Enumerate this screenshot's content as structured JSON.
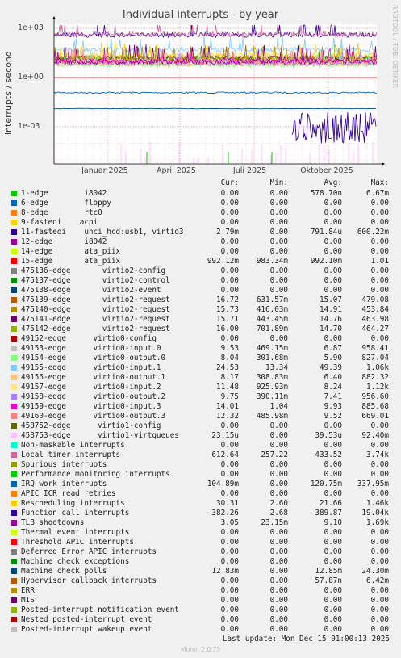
{
  "chart_data": {
    "type": "line",
    "title": "Individual interrupts - by year",
    "ylabel": "interrupts / second",
    "y_scale": "log",
    "y_ticks": [
      "1e+03",
      "1e+00",
      "1e-03"
    ],
    "x_ticks": [
      "Januar 2025",
      "April 2025",
      "Juli 2025",
      "Oktober 2025"
    ],
    "grid": true,
    "watermark": "RRDTOOL / TOBI OETIKER",
    "columns": [
      "Cur:",
      "Min:",
      "Avg:",
      "Max:"
    ],
    "series": [
      {
        "name": "1-edge        i8042",
        "color": "#00cc00",
        "cur": "0.00",
        "min": "0.00",
        "avg": "578.70n",
        "max": "6.67m"
      },
      {
        "name": "6-edge        floppy",
        "color": "#0066b3",
        "cur": "0.00",
        "min": "0.00",
        "avg": "0.00",
        "max": "0.00"
      },
      {
        "name": "8-edge        rtc0",
        "color": "#ff8000",
        "cur": "0.00",
        "min": "0.00",
        "avg": "0.00",
        "max": "0.00"
      },
      {
        "name": "9-fasteoi    acpi",
        "color": "#ffcc00",
        "cur": "0.00",
        "min": "0.00",
        "avg": "0.00",
        "max": "0.00"
      },
      {
        "name": "11-fasteoi    uhci_hcd:usb1, virtio3",
        "color": "#330099",
        "cur": "2.79m",
        "min": "0.00",
        "avg": "791.84u",
        "max": "600.22m"
      },
      {
        "name": "12-edge       i8042",
        "color": "#990099",
        "cur": "0.00",
        "min": "0.00",
        "avg": "0.00",
        "max": "0.00"
      },
      {
        "name": "14-edge       ata_piix",
        "color": "#ccff00",
        "cur": "0.00",
        "min": "0.00",
        "avg": "0.00",
        "max": "0.00"
      },
      {
        "name": "15-edge       ata_piix",
        "color": "#ff0000",
        "cur": "992.12m",
        "min": "983.34m",
        "avg": "992.10m",
        "max": "1.01"
      },
      {
        "name": "475136-edge       virtio2-config",
        "color": "#808080",
        "cur": "0.00",
        "min": "0.00",
        "avg": "0.00",
        "max": "0.00"
      },
      {
        "name": "475137-edge       virtio2-control",
        "color": "#008f00",
        "cur": "0.00",
        "min": "0.00",
        "avg": "0.00",
        "max": "0.00"
      },
      {
        "name": "475138-edge       virtio2-event",
        "color": "#00487d",
        "cur": "0.00",
        "min": "0.00",
        "avg": "0.00",
        "max": "0.00"
      },
      {
        "name": "475139-edge       virtio2-request",
        "color": "#b35a00",
        "cur": "16.72",
        "min": "631.57m",
        "avg": "15.07",
        "max": "479.08"
      },
      {
        "name": "475140-edge       virtio2-request",
        "color": "#b38f00",
        "cur": "15.73",
        "min": "416.03m",
        "avg": "14.91",
        "max": "453.84"
      },
      {
        "name": "475141-edge       virtio2-request",
        "color": "#6b006b",
        "cur": "15.71",
        "min": "443.45m",
        "avg": "14.76",
        "max": "463.98"
      },
      {
        "name": "475142-edge       virtio2-request",
        "color": "#8fb300",
        "cur": "16.00",
        "min": "701.89m",
        "avg": "14.70",
        "max": "464.27"
      },
      {
        "name": "49152-edge      virtio0-config",
        "color": "#b30000",
        "cur": "0.00",
        "min": "0.00",
        "avg": "0.00",
        "max": "0.00"
      },
      {
        "name": "49153-edge      virtio0-input.0",
        "color": "#bebebe",
        "cur": "9.53",
        "min": "469.15m",
        "avg": "6.87",
        "max": "958.41"
      },
      {
        "name": "49154-edge      virtio0-output.0",
        "color": "#80ff80",
        "cur": "8.04",
        "min": "301.68m",
        "avg": "5.90",
        "max": "827.04"
      },
      {
        "name": "49155-edge      virtio0-input.1",
        "color": "#80c9ff",
        "cur": "24.53",
        "min": "13.34",
        "avg": "49.39",
        "max": "1.06k"
      },
      {
        "name": "49156-edge      virtio0-output.1",
        "color": "#ffc080",
        "cur": "8.17",
        "min": "308.83m",
        "avg": "6.40",
        "max": "882.32"
      },
      {
        "name": "49157-edge      virtio0-input.2",
        "color": "#ffe680",
        "cur": "11.48",
        "min": "925.93m",
        "avg": "8.24",
        "max": "1.12k"
      },
      {
        "name": "49158-edge      virtio0-output.2",
        "color": "#aa80ff",
        "cur": "9.75",
        "min": "390.11m",
        "avg": "7.41",
        "max": "956.60"
      },
      {
        "name": "49159-edge      virtio0-input.3",
        "color": "#ee00cc",
        "cur": "14.01",
        "min": "1.04",
        "avg": "9.93",
        "max": "885.68"
      },
      {
        "name": "49160-edge      virtio0-output.3",
        "color": "#ff8080",
        "cur": "12.32",
        "min": "485.98m",
        "avg": "9.52",
        "max": "669.01"
      },
      {
        "name": "458752-edge      virtio1-config",
        "color": "#666600",
        "cur": "0.00",
        "min": "0.00",
        "avg": "0.00",
        "max": "0.00"
      },
      {
        "name": "458753-edge      virtio1-virtqueues",
        "color": "#ffbfff",
        "cur": "23.15u",
        "min": "0.00",
        "avg": "39.53u",
        "max": "92.40m"
      },
      {
        "name": "Non-maskable interrupts",
        "color": "#00ffcc",
        "cur": "0.00",
        "min": "0.00",
        "avg": "0.00",
        "max": "0.00"
      },
      {
        "name": "Local timer interrupts",
        "color": "#cc6699",
        "cur": "612.64",
        "min": "257.22",
        "avg": "433.52",
        "max": "3.74k"
      },
      {
        "name": "Spurious interrupts",
        "color": "#999900",
        "cur": "0.00",
        "min": "0.00",
        "avg": "0.00",
        "max": "0.00"
      },
      {
        "name": "Performance monitoring interrupts",
        "color": "#00cc00",
        "cur": "0.00",
        "min": "0.00",
        "avg": "0.00",
        "max": "0.00"
      },
      {
        "name": "IRQ work interrupts",
        "color": "#0066b3",
        "cur": "104.89m",
        "min": "0.00",
        "avg": "120.75m",
        "max": "337.95m"
      },
      {
        "name": "APIC ICR read retries",
        "color": "#ff8000",
        "cur": "0.00",
        "min": "0.00",
        "avg": "0.00",
        "max": "0.00"
      },
      {
        "name": "Rescheduling interrupts",
        "color": "#ffcc00",
        "cur": "30.31",
        "min": "2.60",
        "avg": "21.66",
        "max": "1.46k"
      },
      {
        "name": "Function call interrupts",
        "color": "#330099",
        "cur": "382.26",
        "min": "2.68",
        "avg": "389.87",
        "max": "19.04k"
      },
      {
        "name": "TLB shootdowns",
        "color": "#990099",
        "cur": "3.05",
        "min": "23.15m",
        "avg": "9.10",
        "max": "1.69k"
      },
      {
        "name": "Thermal event interrupts",
        "color": "#ccff00",
        "cur": "0.00",
        "min": "0.00",
        "avg": "0.00",
        "max": "0.00"
      },
      {
        "name": "Threshold APIC interrupts",
        "color": "#ff0000",
        "cur": "0.00",
        "min": "0.00",
        "avg": "0.00",
        "max": "0.00"
      },
      {
        "name": "Deferred Error APIC interrupts",
        "color": "#808080",
        "cur": "0.00",
        "min": "0.00",
        "avg": "0.00",
        "max": "0.00"
      },
      {
        "name": "Machine check exceptions",
        "color": "#008f00",
        "cur": "0.00",
        "min": "0.00",
        "avg": "0.00",
        "max": "0.00"
      },
      {
        "name": "Machine check polls",
        "color": "#00487d",
        "cur": "12.83m",
        "min": "0.00",
        "avg": "12.85m",
        "max": "24.30m"
      },
      {
        "name": "Hypervisor callback interrupts",
        "color": "#b35a00",
        "cur": "0.00",
        "min": "0.00",
        "avg": "57.87n",
        "max": "6.42m"
      },
      {
        "name": "ERR",
        "color": "#b38f00",
        "cur": "0.00",
        "min": "0.00",
        "avg": "0.00",
        "max": "0.00"
      },
      {
        "name": "MIS",
        "color": "#6b006b",
        "cur": "0.00",
        "min": "0.00",
        "avg": "0.00",
        "max": "0.00"
      },
      {
        "name": "Posted-interrupt notification event",
        "color": "#8fb300",
        "cur": "0.00",
        "min": "0.00",
        "avg": "0.00",
        "max": "0.00"
      },
      {
        "name": "Nested posted-interrupt event",
        "color": "#b30000",
        "cur": "0.00",
        "min": "0.00",
        "avg": "0.00",
        "max": "0.00"
      },
      {
        "name": "Posted-interrupt wakeup event",
        "color": "#bebebe",
        "cur": "0.00",
        "min": "0.00",
        "avg": "0.00",
        "max": "0.00"
      }
    ]
  },
  "footer": {
    "last_update": "Last update: Mon Dec 15 01:00:13 2025",
    "version": "Munin 2.0.73"
  }
}
